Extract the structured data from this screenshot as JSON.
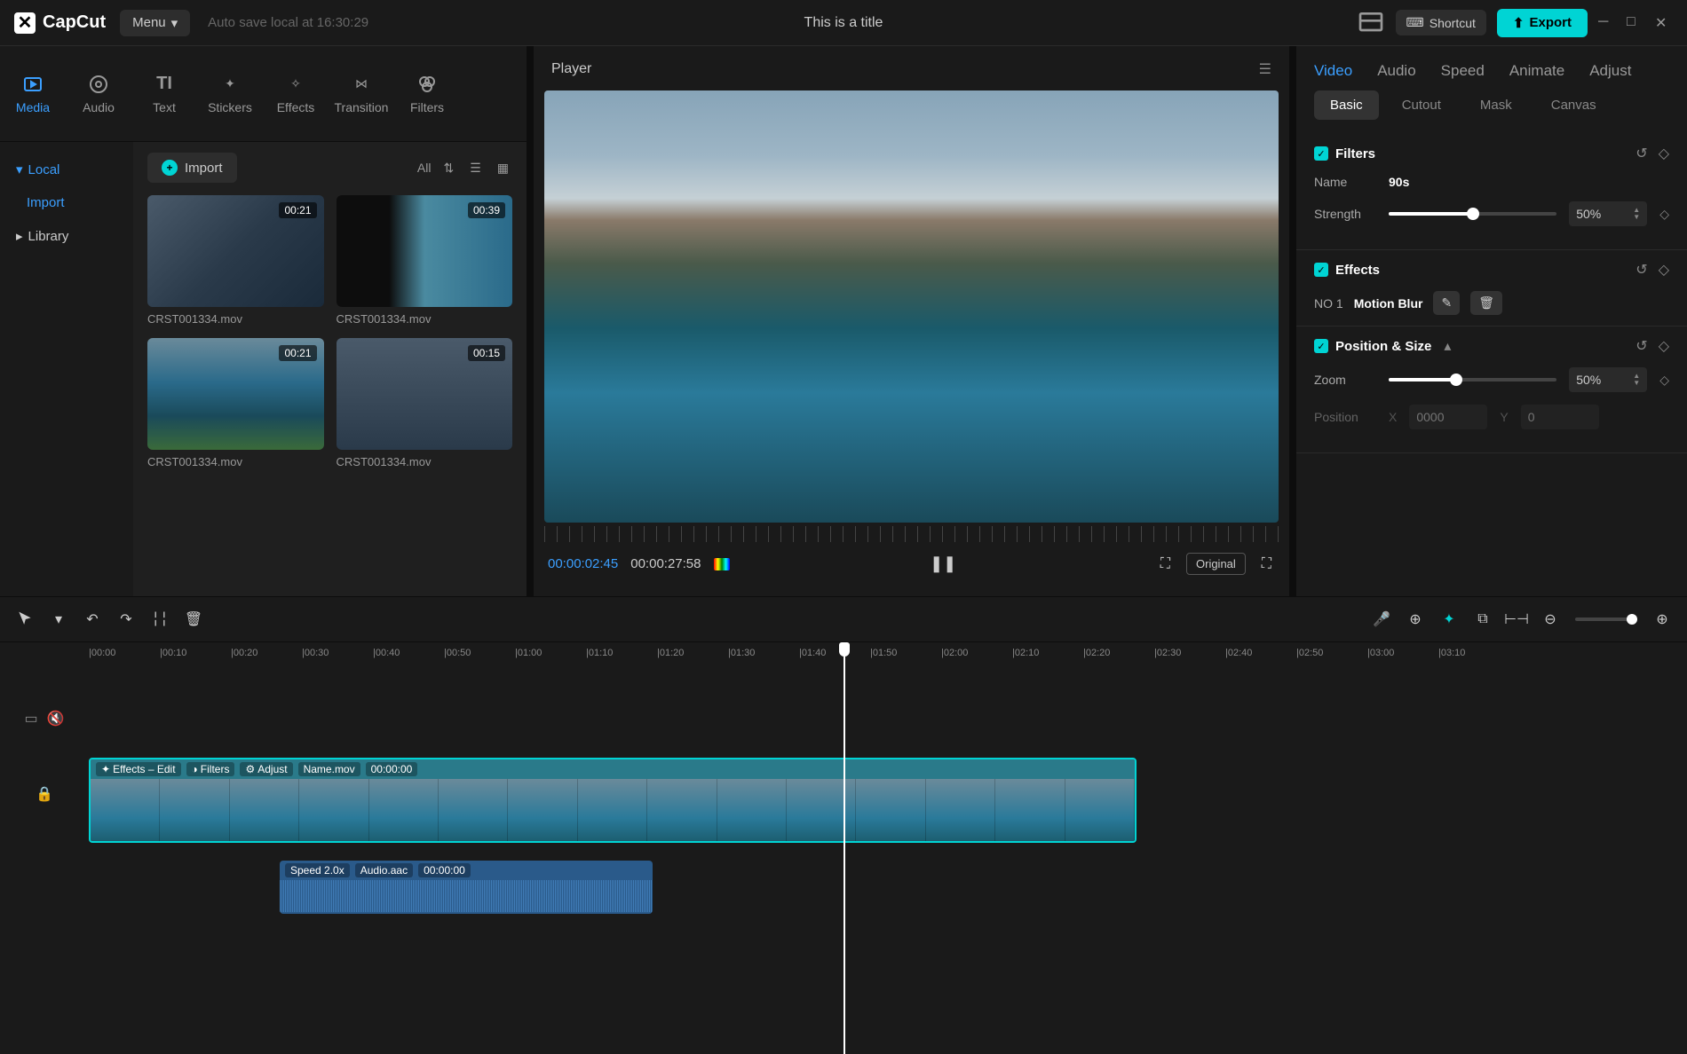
{
  "titlebar": {
    "app_name": "CapCut",
    "menu_label": "Menu",
    "autosave": "Auto save local at 16:30:29",
    "title": "This is a title",
    "shortcut_label": "Shortcut",
    "export_label": "Export"
  },
  "top_tabs": [
    "Media",
    "Audio",
    "Text",
    "Stickers",
    "Effects",
    "Transition",
    "Filters"
  ],
  "sidebar": {
    "local": "Local",
    "import": "Import",
    "library": "Library"
  },
  "media": {
    "import_btn": "Import",
    "all": "All",
    "items": [
      {
        "name": "CRST001334.mov",
        "dur": "00:21"
      },
      {
        "name": "CRST001334.mov",
        "dur": "00:39"
      },
      {
        "name": "CRST001334.mov",
        "dur": "00:21"
      },
      {
        "name": "CRST001334.mov",
        "dur": "00:15"
      }
    ]
  },
  "player": {
    "title": "Player",
    "cur": "00:00:02:45",
    "total": "00:00:27:58",
    "original": "Original"
  },
  "right": {
    "tabs": [
      "Video",
      "Audio",
      "Speed",
      "Animate",
      "Adjust"
    ],
    "subtabs": [
      "Basic",
      "Cutout",
      "Mask",
      "Canvas"
    ],
    "filters": {
      "title": "Filters",
      "name_label": "Name",
      "name_value": "90s",
      "strength_label": "Strength",
      "strength_value": "50%"
    },
    "effects": {
      "title": "Effects",
      "no_label": "NO 1",
      "name": "Motion Blur"
    },
    "pos": {
      "title": "Position & Size",
      "zoom_label": "Zoom",
      "zoom_value": "50%",
      "position_label": "Position",
      "x": "0000",
      "y": "0"
    }
  },
  "timeline": {
    "ticks": [
      "00:00",
      "00:10",
      "00:20",
      "00:30",
      "00:40",
      "00:50",
      "01:00",
      "01:10",
      "01:20",
      "01:30",
      "01:40",
      "01:50",
      "02:00",
      "02:10",
      "02:20",
      "02:30",
      "02:40",
      "02:50",
      "03:00",
      "03:10"
    ],
    "video_clip": {
      "tags": [
        "Effects – Edit",
        "Filters",
        "Adjust"
      ],
      "name": "Name.mov",
      "time": "00:00:00"
    },
    "audio_clip": {
      "speed": "Speed 2.0x",
      "name": "Audio.aac",
      "time": "00:00:00"
    }
  }
}
